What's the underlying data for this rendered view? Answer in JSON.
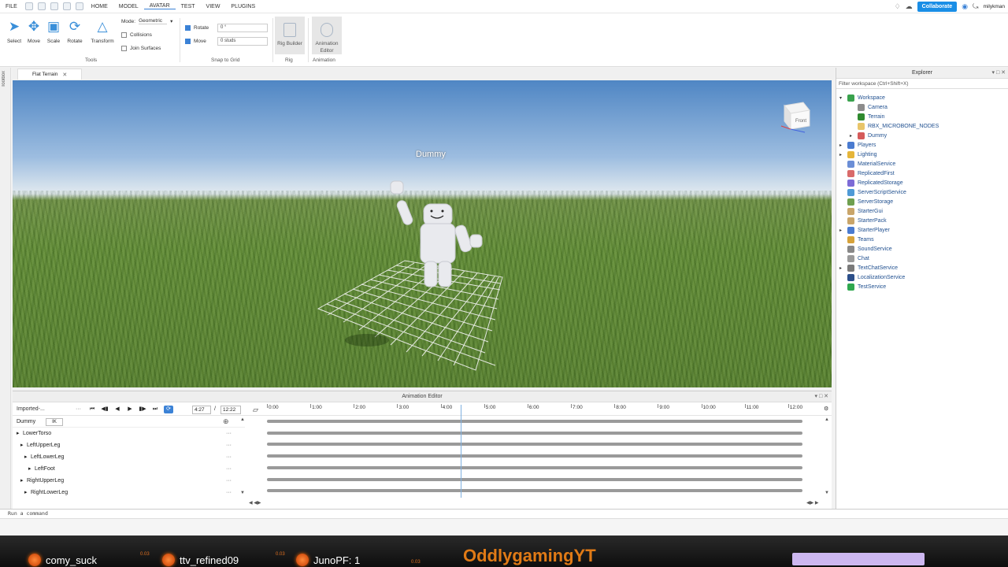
{
  "menubar": {
    "items": [
      "FILE",
      "HOME",
      "MODEL",
      "AVATAR",
      "TEST",
      "VIEW",
      "PLUGINS"
    ],
    "collaborate": "Collaborate",
    "username": "milykman"
  },
  "ribbon": {
    "tools": [
      "Select",
      "Move",
      "Scale",
      "Rotate",
      "Transform"
    ],
    "mode_label": "Mode:",
    "mode_value": "Geometric",
    "collisions": "Collisions",
    "join_surfaces": "Join Surfaces",
    "tools_group": "Tools",
    "rotate_label": "Rotate",
    "rotate_value": "0 °",
    "move_label": "Move",
    "move_value": "0 studs",
    "snap_group": "Snap to Grid",
    "rig_builder": "Rig Builder",
    "rig_group": "Rig",
    "animation_editor": "Animation Editor",
    "animation_group": "Animation"
  },
  "leftstrip": {
    "label": "Toolbox"
  },
  "tab": {
    "label": "Flat Terrain"
  },
  "viewport": {
    "dummy_label": "Dummy",
    "viewcube_label": "Front"
  },
  "explorer": {
    "title": "Explorer",
    "filter_placeholder": "Filter workspace (Ctrl+Shift+X)",
    "nodes": [
      {
        "label": "Workspace",
        "icon": "globe-icon",
        "color": "#39a24d"
      },
      {
        "label": "Camera",
        "icon": "camera-icon",
        "color": "#8c8c8c"
      },
      {
        "label": "Terrain",
        "icon": "terrain-icon",
        "color": "#2f8a2f"
      },
      {
        "label": "RBX_MICROBONE_NODES",
        "icon": "folder-icon",
        "color": "#e8c56a"
      },
      {
        "label": "Dummy",
        "icon": "model-icon",
        "color": "#d55b5b"
      },
      {
        "label": "Players",
        "icon": "players-icon",
        "color": "#4a7bd0"
      },
      {
        "label": "Lighting",
        "icon": "lighting-icon",
        "color": "#e5b53a"
      },
      {
        "label": "MaterialService",
        "icon": "material-icon",
        "color": "#6b8ed6"
      },
      {
        "label": "ReplicatedFirst",
        "icon": "replicated-icon",
        "color": "#d96a6a"
      },
      {
        "label": "ReplicatedStorage",
        "icon": "storage-icon",
        "color": "#7d6bd6"
      },
      {
        "label": "ServerScriptService",
        "icon": "script-service-icon",
        "color": "#4f9ad6"
      },
      {
        "label": "ServerStorage",
        "icon": "server-storage-icon",
        "color": "#6f9f4f"
      },
      {
        "label": "StarterGui",
        "icon": "gui-icon",
        "color": "#c9a56a"
      },
      {
        "label": "StarterPack",
        "icon": "pack-icon",
        "color": "#c9a56a"
      },
      {
        "label": "StarterPlayer",
        "icon": "player-icon",
        "color": "#4a7bd0"
      },
      {
        "label": "Teams",
        "icon": "teams-icon",
        "color": "#d6a23a"
      },
      {
        "label": "SoundService",
        "icon": "sound-icon",
        "color": "#888888"
      },
      {
        "label": "Chat",
        "icon": "chat-icon",
        "color": "#9a9a9a"
      },
      {
        "label": "TextChatService",
        "icon": "text-chat-icon",
        "color": "#7a7a7a"
      },
      {
        "label": "LocalizationService",
        "icon": "localization-icon",
        "color": "#2c4f8a"
      },
      {
        "label": "TestService",
        "icon": "test-icon",
        "color": "#2fa84f"
      }
    ]
  },
  "anim": {
    "title": "Animation Editor",
    "imported": "Imported-...",
    "current_time": "4:27",
    "separator": "/",
    "end_time": "12:22",
    "rig_name": "Dummy",
    "ik": "IK",
    "ticks": [
      "0:00",
      "1:00",
      "2:00",
      "3:00",
      "4:00",
      "5:00",
      "6:00",
      "7:00",
      "8:00",
      "9:00",
      "10:00",
      "11:00",
      "12:00"
    ],
    "tracks": [
      "LowerTorso",
      "LeftUpperLeg",
      "LeftLowerLeg",
      "LeftFoot",
      "RightUpperLeg",
      "RightLowerLeg"
    ],
    "playhead_fraction": 0.362
  },
  "command": {
    "placeholder": "Run a command"
  },
  "overlay": {
    "users": [
      "comy_suck",
      "ttv_refined09",
      "JunoPF: 1"
    ],
    "small_values": [
      "0.03",
      "0.03",
      "0.03"
    ],
    "highlight": "OddlygamingYT"
  }
}
